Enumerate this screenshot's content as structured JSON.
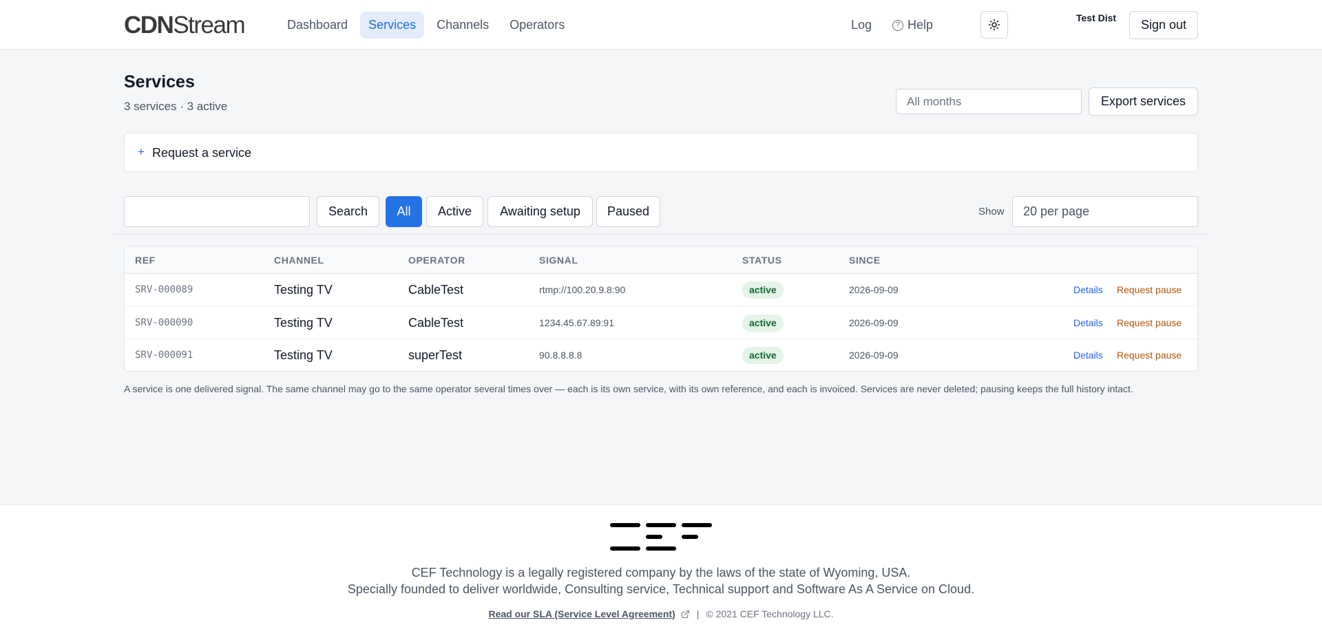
{
  "header": {
    "logo_bold": "CDN",
    "logo_light": "Stream",
    "nav": [
      {
        "label": "Dashboard"
      },
      {
        "label": "Services",
        "active": true
      },
      {
        "label": "Channels"
      },
      {
        "label": "Operators"
      }
    ],
    "log_label": "Log",
    "help_label": "Help",
    "theme_icon": "sun-icon",
    "user_name": "Test Dist",
    "signout_label": "Sign out"
  },
  "page": {
    "title": "Services",
    "subtitle": "3 services · 3 active",
    "month_filter": "All months",
    "export_label": "Export services",
    "request_plus": "+",
    "request_label": "Request a service"
  },
  "filters": {
    "search_value": "",
    "search_button": "Search",
    "tabs": [
      {
        "label": "All",
        "active": true
      },
      {
        "label": "Active"
      },
      {
        "label": "Awaiting setup"
      },
      {
        "label": "Paused"
      }
    ],
    "show_label": "Show",
    "per_page": "20 per page"
  },
  "table": {
    "columns": [
      "REF",
      "CHANNEL",
      "OPERATOR",
      "SIGNAL",
      "STATUS",
      "SINCE"
    ],
    "rows": [
      {
        "ref": "SRV-000089",
        "channel": "Testing TV",
        "operator": "CableTest",
        "signal": "rtmp://100.20.9.8:90",
        "status": "active",
        "since": "2026-09-09",
        "details": "Details",
        "pause": "Request pause"
      },
      {
        "ref": "SRV-000090",
        "channel": "Testing TV",
        "operator": "CableTest",
        "signal": "1234.45.67.89:91",
        "status": "active",
        "since": "2026-09-09",
        "details": "Details",
        "pause": "Request pause"
      },
      {
        "ref": "SRV-000091",
        "channel": "Testing TV",
        "operator": "superTest",
        "signal": "90.8.8.8.8",
        "status": "active",
        "since": "2026-09-09",
        "details": "Details",
        "pause": "Request pause"
      }
    ]
  },
  "note": "A service is one delivered signal. The same channel may go to the same operator several times over — each is its own service, with its own reference, and each is invoiced. Services are never deleted; pausing keeps the full history intact.",
  "footer": {
    "line1": "CEF Technology is a legally registered company by the laws of the state of Wyoming, USA.",
    "line2": "Specially founded to deliver worldwide, Consulting service, Technical support and Software As A Service on Cloud.",
    "sla_link": "Read our SLA (Service Level Agreement)",
    "separator": "|",
    "copyright": "© 2021 CEF Technology LLC."
  },
  "colors": {
    "accent": "#2473e6",
    "nav_active_bg": "#e2ecfb",
    "status_bg": "#e4f4e8",
    "status_text": "#166534",
    "pause_link": "#b45309"
  }
}
